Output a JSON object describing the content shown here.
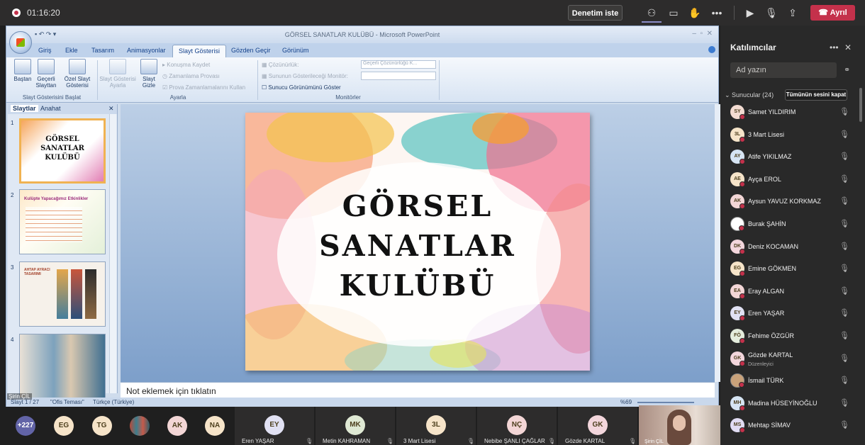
{
  "topbar": {
    "timer": "01:16:20",
    "control_button": "Denetim iste",
    "leave_button": "Ayrıl",
    "leave_color": "#c4314b"
  },
  "powerpoint": {
    "window_title": "GÖRSEL SANATLAR KULÜBÜ - Microsoft PowerPoint",
    "tabs": [
      "Giriş",
      "Ekle",
      "Tasarım",
      "Animasyonlar",
      "Slayt Gösterisi",
      "Gözden Geçir",
      "Görünüm"
    ],
    "active_tab": "Slayt Gösterisi",
    "ribbon": {
      "from_start": "Baştan",
      "from_current": "Geçerli Slayttan",
      "custom_show": "Özel Slayt Gösterisi",
      "group_start": "Slayt Gösterisini Başlat",
      "setup_show": "Slayt Gösterisi Ayarla",
      "hide_slide": "Slayt Gizle",
      "record_narration": "Konuşma Kaydet",
      "rehearse": "Zamanlama Provası",
      "use_timings": "Prova Zamanlamalarını Kullan",
      "group_setup": "Ayarla",
      "resolution": "Çözünürlük:",
      "resolution_value": "Geçerli Çözünürlüğü K...",
      "show_on": "Sununun Gösterileceği Monitör:",
      "presenter_view": "Sunucu Görünümünü Göster",
      "group_monitors": "Monitörler"
    },
    "left_tabs": [
      "Slaytlar",
      "Anahat"
    ],
    "slide_numbers": [
      "1",
      "2",
      "3",
      "4"
    ],
    "thumb1_lines": [
      "GÖRSEL",
      "SANATLAR",
      "KULÜBÜ"
    ],
    "thumb2_title": "Kulüpte Yapacağımız Etkinlikler",
    "thumb3_title": "AHTAP AYRACI TASARIMI",
    "slide_title_lines": [
      "GÖRSEL",
      "SANATLAR",
      "KULÜBÜ"
    ],
    "notes_placeholder": "Not eklemek için tıklatın",
    "status": {
      "slide_info": "Slayt 1 / 27",
      "theme": "\"Ofis Teması\"",
      "language": "Türkçe (Türkiye)",
      "zoom": "%69"
    }
  },
  "presenter_label": "Şirin ÇİL",
  "sidebar": {
    "title": "Katılımcılar",
    "search_placeholder": "Ad yazın",
    "section": "Sunucular (24)",
    "mute_all": "Tümünün sesini kapat",
    "participants": [
      {
        "initials": "SY",
        "name": "Samet YILDIRIM",
        "color": "#f3dcd2"
      },
      {
        "initials": "3L",
        "name": "3 Mart Lisesi",
        "color": "#f6e4c9"
      },
      {
        "initials": "AY",
        "name": "Atife YIKILMAZ",
        "color": "#d6e4f3"
      },
      {
        "initials": "AE",
        "name": "Ayça EROL",
        "color": "#f6e4c9"
      },
      {
        "initials": "AK",
        "name": "Aysun YAVUZ KORKMAZ",
        "color": "#f3d6d6"
      },
      {
        "initials": "",
        "name": "Burak ŞAHİN",
        "color": "#ffffff"
      },
      {
        "initials": "DK",
        "name": "Deniz KOCAMAN",
        "color": "#f3d6dc"
      },
      {
        "initials": "EG",
        "name": "Emine GÖKMEN",
        "color": "#f6e4c9"
      },
      {
        "initials": "EA",
        "name": "Eray ALGAN",
        "color": "#f3d6d6"
      },
      {
        "initials": "EY",
        "name": "Eren YAŞAR",
        "color": "#e1e1f3"
      },
      {
        "initials": "FÖ",
        "name": "Fehime ÖZGÜR",
        "color": "#e4ecdc"
      },
      {
        "initials": "GK",
        "name": "Gözde KARTAL",
        "color": "#f3d6dc",
        "sub": "Düzenleyici"
      },
      {
        "initials": "",
        "name": "İsmail TÜRK",
        "color": "#c9a27a"
      },
      {
        "initials": "MH",
        "name": "Madina HÜSEYİNOĞLU",
        "color": "#d6e4f3"
      },
      {
        "initials": "MS",
        "name": "Mehtap SİMAV",
        "color": "#e1dcf3"
      }
    ]
  },
  "bottom": {
    "overflow": "+227",
    "circles": [
      {
        "initials": "EG",
        "color": "#f6e4c9"
      },
      {
        "initials": "TG",
        "color": "#f6e4c9"
      },
      {
        "initials": "AK",
        "color": "#f3d6d6"
      },
      {
        "initials": "NA",
        "color": "#f6e4c9"
      }
    ],
    "tiles": [
      {
        "initials": "EY",
        "name": "Eren YAŞAR",
        "color": "#e1e1f3"
      },
      {
        "initials": "MK",
        "name": "Metin KAHRAMAN",
        "color": "#dfe9d4"
      },
      {
        "initials": "3L",
        "name": "3 Mart Lisesi",
        "color": "#f6e4c9"
      },
      {
        "initials": "NÇ",
        "name": "Nebibe ŞANLI ÇAĞLAR",
        "color": "#f3d6d6"
      },
      {
        "initials": "GK",
        "name": "Gözde KARTAL",
        "color": "#f3d6dc"
      }
    ],
    "video_name": "Şirin ÇİL"
  }
}
